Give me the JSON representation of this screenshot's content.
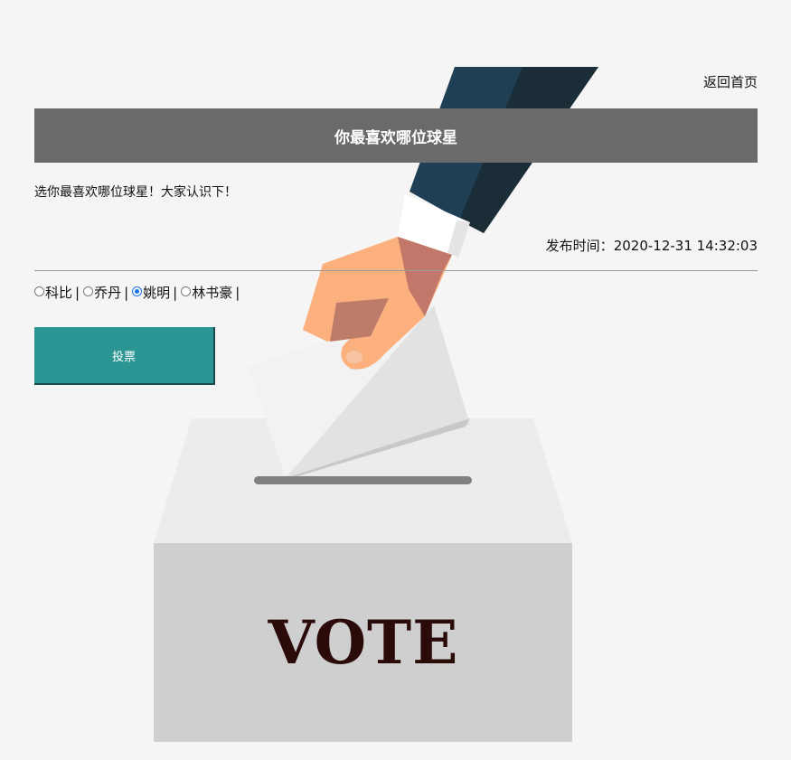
{
  "header": {
    "back_home": "返回首页"
  },
  "poll": {
    "title": "你最喜欢哪位球星",
    "description": "选你最喜欢哪位球星！大家认识下！",
    "publish_label": "发布时间：",
    "publish_time": "2020-12-31 14:32:03",
    "options": [
      {
        "label": "科比",
        "checked": false
      },
      {
        "label": "乔丹",
        "checked": false
      },
      {
        "label": "姚明",
        "checked": true
      },
      {
        "label": "林书豪",
        "checked": false
      }
    ],
    "separator": "|",
    "vote_button": "投票"
  },
  "illustration": {
    "box_text": "VOTE"
  },
  "colors": {
    "title_bar": "#6a6a6a",
    "button": "#2b9594",
    "page_bg": "#f5f5f5",
    "vote_text": "#2b0b0a"
  }
}
